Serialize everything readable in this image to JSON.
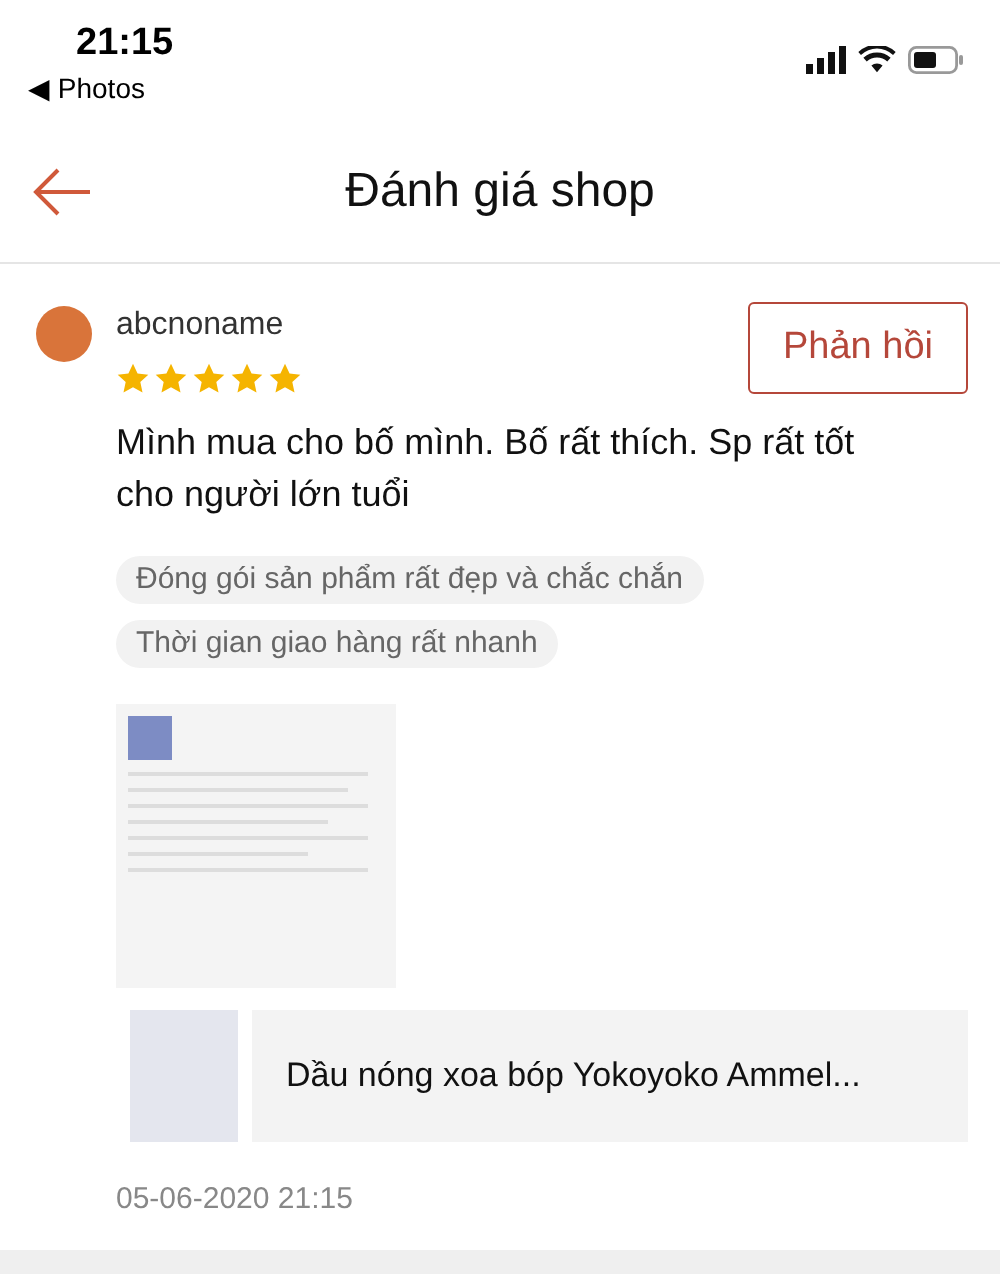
{
  "status_bar": {
    "time": "21:15",
    "back_app": "◀ Photos"
  },
  "header": {
    "title": "Đánh giá shop"
  },
  "review": {
    "username": "abcnoname",
    "stars": 5,
    "reply_button": "Phản hồi",
    "text": "Mình mua cho bố mình. Bố rất thích. Sp rất tốt cho người lớn tuổi",
    "tags": [
      "Đóng gói sản phẩm rất đẹp và chắc chắn",
      "Thời gian giao hàng rất nhanh"
    ],
    "product": {
      "name": "Dầu nóng xoa bóp Yokoyoko Ammel..."
    },
    "date": "05-06-2020 21:15"
  }
}
